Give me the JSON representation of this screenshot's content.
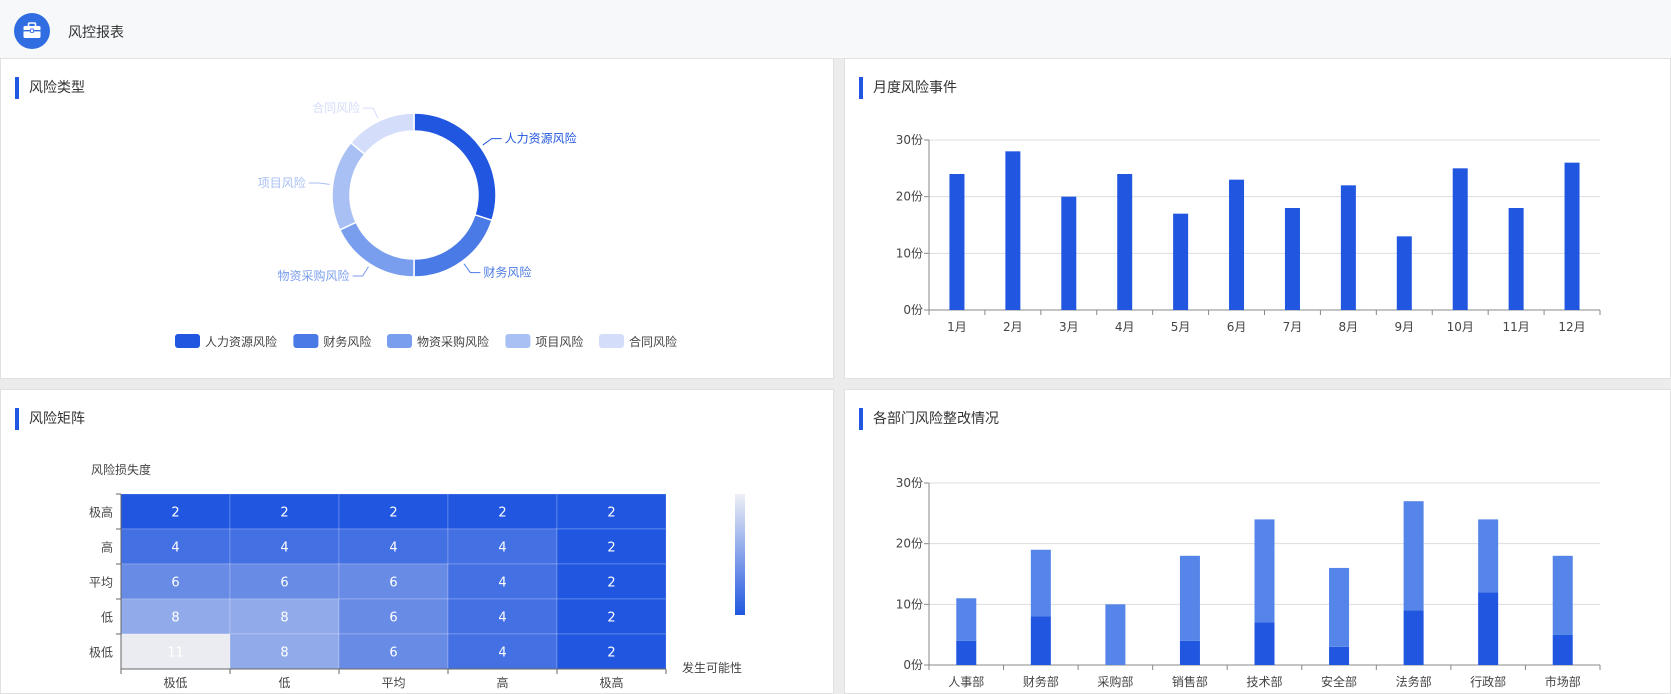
{
  "header": {
    "title": "风控报表",
    "logo_icon": "briefcase-icon"
  },
  "panels": {
    "risk_types": {
      "title": "风险类型"
    },
    "monthly": {
      "title": "月度风险事件"
    },
    "matrix": {
      "title": "风险矩阵"
    },
    "departments": {
      "title": "各部门风险整改情况"
    }
  },
  "colors": {
    "primary": "#2056e0",
    "header_bg": "#f7f8fa"
  },
  "chart_data": [
    {
      "id": "risk-type-donut",
      "type": "pie",
      "title": "风险类型",
      "labels": [
        "人力资源风险",
        "财务风险",
        "物资采购风险",
        "项目风险",
        "合同风险"
      ],
      "values": [
        30,
        20,
        18,
        18,
        14
      ],
      "colors": [
        "#2056e0",
        "#4a7ae6",
        "#7a9eee",
        "#a9c0f4",
        "#d4defa"
      ],
      "legend": "bottom"
    },
    {
      "id": "monthly-events",
      "type": "bar",
      "title": "月度风险事件",
      "categories": [
        "1月",
        "2月",
        "3月",
        "4月",
        "5月",
        "6月",
        "7月",
        "8月",
        "9月",
        "10月",
        "11月",
        "12月"
      ],
      "values": [
        24,
        28,
        20,
        24,
        17,
        23,
        18,
        22,
        13,
        25,
        18,
        26
      ],
      "ylim": [
        0,
        30
      ],
      "yticks": [
        "0份",
        "10份",
        "20份",
        "30份"
      ],
      "grid": true
    },
    {
      "id": "risk-matrix",
      "type": "heatmap",
      "title": "风险矩阵",
      "ylabel": "风险损失度",
      "xlabel": "发生可能性",
      "x": [
        "极低",
        "低",
        "平均",
        "高",
        "极高"
      ],
      "y": [
        "极高",
        "高",
        "平均",
        "低",
        "极低"
      ],
      "values": [
        [
          2,
          2,
          2,
          2,
          2
        ],
        [
          4,
          4,
          4,
          4,
          2
        ],
        [
          6,
          6,
          6,
          4,
          2
        ],
        [
          8,
          8,
          6,
          4,
          2
        ],
        [
          11,
          8,
          6,
          4,
          2
        ]
      ]
    },
    {
      "id": "department-rectification",
      "type": "bar",
      "title": "各部门风险整改情况",
      "categories": [
        "人事部",
        "财务部",
        "采购部",
        "销售部",
        "技术部",
        "安全部",
        "法务部",
        "行政部",
        "市场部"
      ],
      "series": [
        {
          "values": [
            4,
            8,
            0,
            4,
            7,
            3,
            9,
            12,
            5
          ],
          "color": "#2056e0"
        },
        {
          "values": [
            7,
            11,
            10,
            14,
            17,
            13,
            18,
            12,
            13
          ],
          "color": "#5585e8"
        }
      ],
      "stacked": true,
      "ylim": [
        0,
        30
      ],
      "yticks": [
        "0份",
        "10份",
        "20份",
        "30份"
      ],
      "grid": true
    }
  ]
}
